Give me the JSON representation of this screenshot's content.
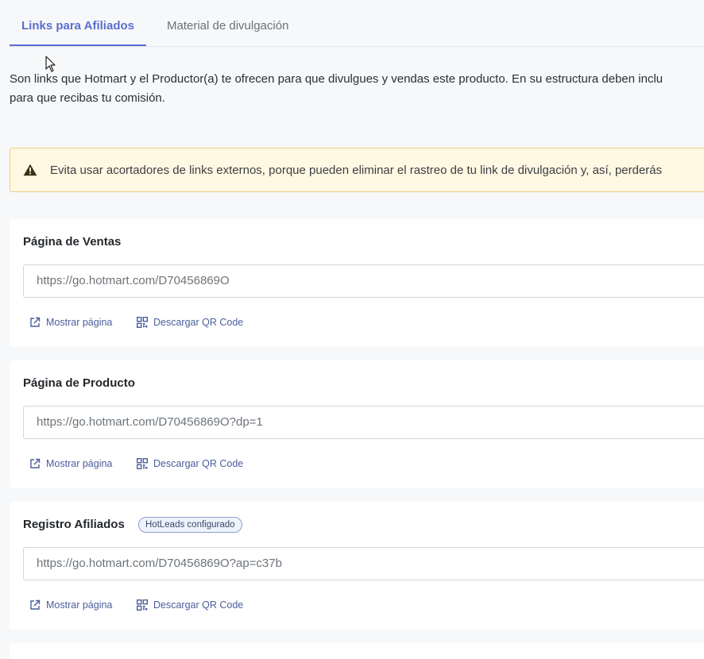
{
  "tabs": [
    {
      "label": "Links para Afiliados",
      "active": true
    },
    {
      "label": "Material de divulgación",
      "active": false
    }
  ],
  "intro": {
    "line1": "Son links que Hotmart y el Productor(a) te ofrecen para que divulgues y vendas este producto. En su estructura deben inclu",
    "line2": "para que recibas tu comisión."
  },
  "alert": {
    "icon": "warning-icon",
    "text": "Evita usar acortadores de links externos, porque pueden eliminar el rastreo de tu link de divulgación y, así, perderás"
  },
  "cards": [
    {
      "title": "Página de Ventas",
      "badge": "",
      "url": "https://go.hotmart.com/D70456869O",
      "show_page_label": "Mostrar página",
      "qr_label": "Descargar QR Code"
    },
    {
      "title": "Página de Producto",
      "badge": "",
      "url": "https://go.hotmart.com/D70456869O?dp=1",
      "show_page_label": "Mostrar página",
      "qr_label": "Descargar QR Code"
    },
    {
      "title": "Registro Afiliados",
      "badge": "HotLeads configurado",
      "url": "https://go.hotmart.com/D70456869O?ap=c37b",
      "show_page_label": "Mostrar página",
      "qr_label": "Descargar QR Code"
    }
  ],
  "colors": {
    "accent": "#5a6fd0",
    "link": "#4a5f9c",
    "alert_bg": "#fff8e3",
    "alert_border": "#f0d184"
  }
}
